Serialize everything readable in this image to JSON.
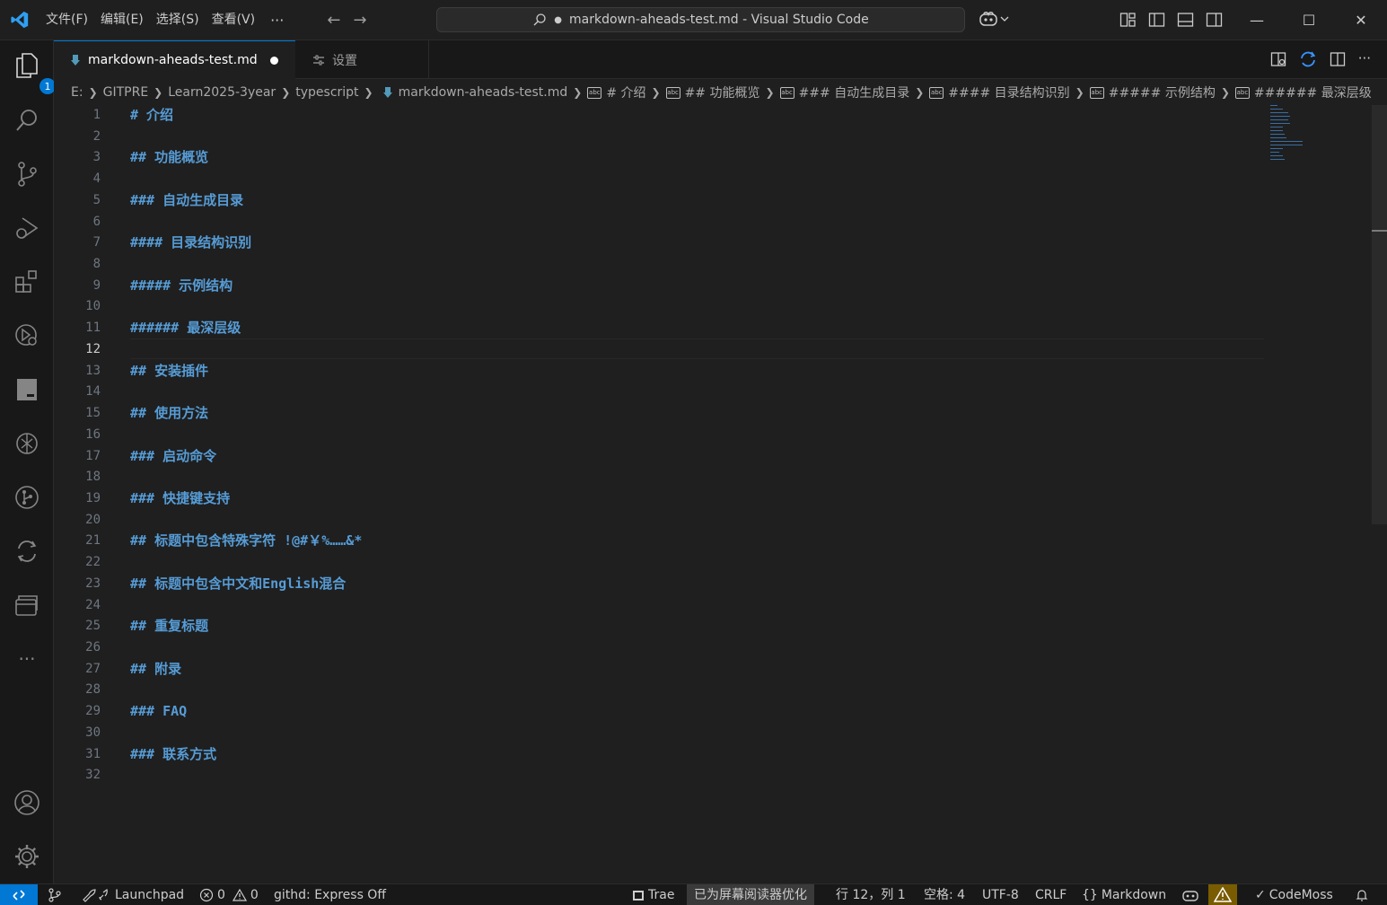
{
  "window": {
    "title": "markdown-aheads-test.md - Visual Studio Code",
    "dirty_marker": "●"
  },
  "menu": {
    "file": "文件(F)",
    "edit": "编辑(E)",
    "selection": "选择(S)",
    "view": "查看(V)",
    "more": "···"
  },
  "tabs": [
    {
      "label": "markdown-aheads-test.md",
      "active": true,
      "dirty": true
    },
    {
      "label": "设置",
      "active": false
    }
  ],
  "activity": {
    "explorer_badge": "1"
  },
  "breadcrumb": {
    "drive": "E:",
    "folder1": "GITPRE",
    "folder2": "Learn2025-3year",
    "folder3": "typescript",
    "file": "markdown-aheads-test.md",
    "symbol_icon_text": "abc",
    "symbols": [
      "# 介绍",
      "## 功能概览",
      "### 自动生成目录",
      "#### 目录结构识别",
      "##### 示例结构",
      "###### 最深层级"
    ]
  },
  "editor": {
    "current_line": 12,
    "lines": [
      "# 介绍",
      "",
      "## 功能概览",
      "",
      "### 自动生成目录",
      "",
      "#### 目录结构识别",
      "",
      "##### 示例结构",
      "",
      "###### 最深层级",
      "",
      "## 安装插件",
      "",
      "## 使用方法",
      "",
      "### 启动命令",
      "",
      "### 快捷键支持",
      "",
      "## 标题中包含特殊字符 !@#￥%……&*",
      "",
      "## 标题中包含中文和English混合",
      "",
      "## 重复标题",
      "",
      "## 附录",
      "",
      "### FAQ",
      "",
      "### 联系方式",
      ""
    ]
  },
  "status": {
    "launchpad": "Launchpad",
    "errors": "0",
    "warnings": "0",
    "githd": "githd: Express Off",
    "trae": "Trae",
    "screen_reader": "已为屏幕阅读器优化",
    "position": "行 12，列 1",
    "spaces": "空格: 4",
    "encoding": "UTF-8",
    "eol": "CRLF",
    "language_braces": "{}",
    "language": "Markdown",
    "codemoss": "CodeMoss"
  },
  "colors": {
    "accent": "#0078d4",
    "heading": "#569cd6",
    "background": "#1f1f1f"
  },
  "icons": [
    "vscode-logo-icon",
    "search-icon",
    "back-arrow-icon",
    "forward-arrow-icon",
    "copilot-icon",
    "customize-layout-icon",
    "toggle-sidebar-icon",
    "toggle-panel-icon",
    "toggle-secondary-sidebar-icon",
    "minimize-icon",
    "maximize-icon",
    "close-icon",
    "explorer-icon",
    "source-control-icon",
    "run-debug-icon",
    "extensions-icon",
    "remote-explorer-icon",
    "terminal-icon",
    "chatgpt-icon",
    "git-graph-icon",
    "sync-icon",
    "folders-icon",
    "more-icon",
    "accounts-icon",
    "settings-gear-icon",
    "markdown-file-icon",
    "settings-tab-icon",
    "open-preview-icon",
    "split-editor-icon",
    "remote-icon",
    "bell-icon"
  ]
}
